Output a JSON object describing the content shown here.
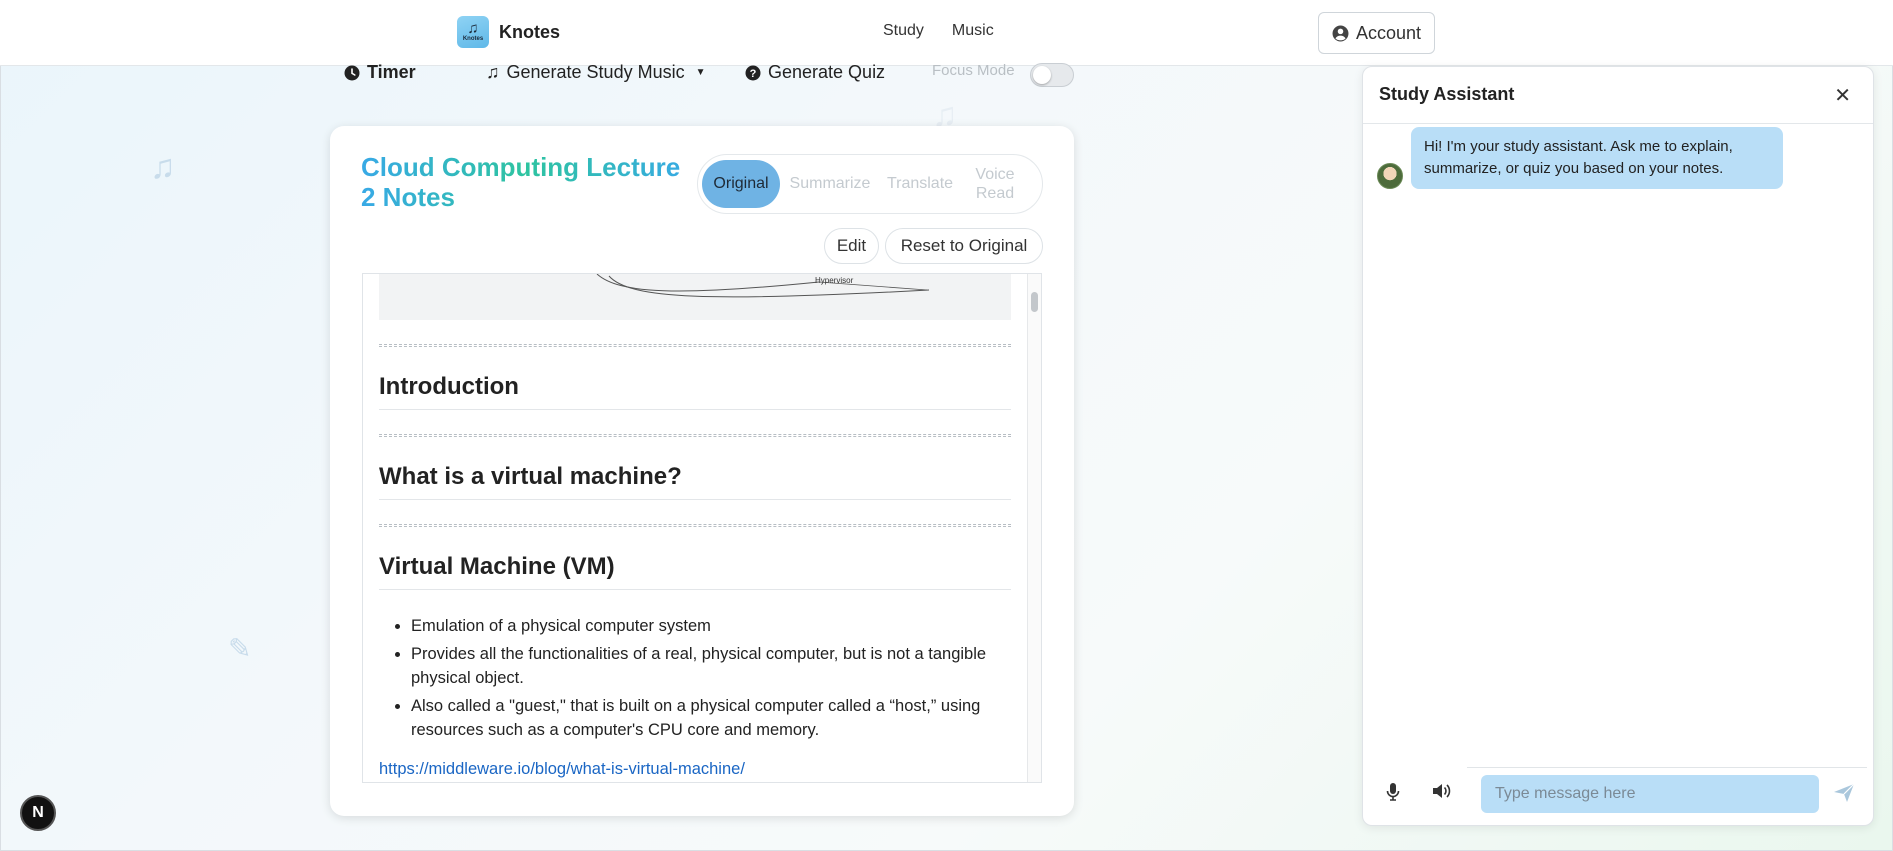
{
  "header": {
    "brand_name": "Knotes",
    "logo_text": "Knotes",
    "nav": {
      "study": "Study",
      "music": "Music"
    },
    "account_label": "Account"
  },
  "toolbar": {
    "timer": "Timer",
    "music": "Generate Study Music",
    "quiz": "Generate Quiz",
    "focus": "Focus Mode"
  },
  "card": {
    "title": "Cloud Computing Lecture 2 Notes",
    "modes": {
      "original": "Original",
      "summarize": "Summarize",
      "translate": "Translate",
      "voice_read": "Voice Read"
    },
    "edit": "Edit",
    "reset": "Reset to Original"
  },
  "doc": {
    "diagram_label": "Hypervisor",
    "h1": "Introduction",
    "h2": "What is a virtual machine?",
    "h3": "Virtual Machine (VM)",
    "bullets": [
      "Emulation of a physical computer system",
      "Provides all the functionalities of a real, physical computer, but is not a tangible physical object.",
      "Also called a \"guest,\" that is built on a physical computer called a “host,” using resources such as a computer's CPU core and memory."
    ],
    "link": "https://middleware.io/blog/what-is-virtual-machine/"
  },
  "chat": {
    "title": "Study Assistant",
    "message": "Hi! I'm your study assistant. Ask me to explain, summarize, or quiz you based on your notes.",
    "placeholder": "Type message here"
  },
  "badge": "N",
  "colors": {
    "accent": "#6fb3e4",
    "bubble": "#b9def7",
    "link": "#1a66c4"
  }
}
